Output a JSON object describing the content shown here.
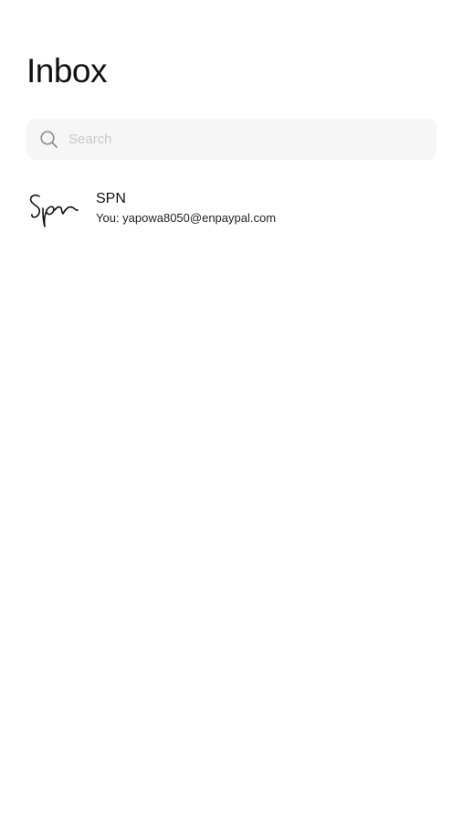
{
  "header": {
    "title": "Inbox"
  },
  "search": {
    "placeholder": "Search",
    "value": "",
    "icon": "search-icon"
  },
  "conversations": [
    {
      "name": "SPN",
      "preview": "You: yapowa8050@enpaypal.com",
      "avatar": "signature-avatar"
    }
  ],
  "colors": {
    "background": "#ffffff",
    "search_background": "#f6f6f7",
    "placeholder": "#c9c9cc",
    "text": "#111111"
  }
}
